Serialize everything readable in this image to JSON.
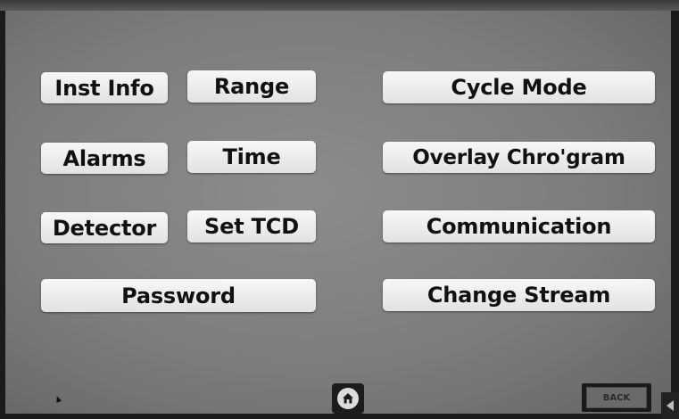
{
  "buttons": {
    "inst_info": "Inst Info",
    "range": "Range",
    "cycle_mode": "Cycle Mode",
    "alarms": "Alarms",
    "time": "Time",
    "overlay": "Overlay Chro'gram",
    "detector": "Detector",
    "set_tcd": "Set TCD",
    "communication": "Communication",
    "password": "Password",
    "change_stream": "Change Stream"
  },
  "nav": {
    "back_label": "BACK",
    "home_icon": "home-icon"
  },
  "colors": {
    "screen_bg": "#808080",
    "button_bg": "#f0f0f0",
    "button_text": "#111111"
  }
}
